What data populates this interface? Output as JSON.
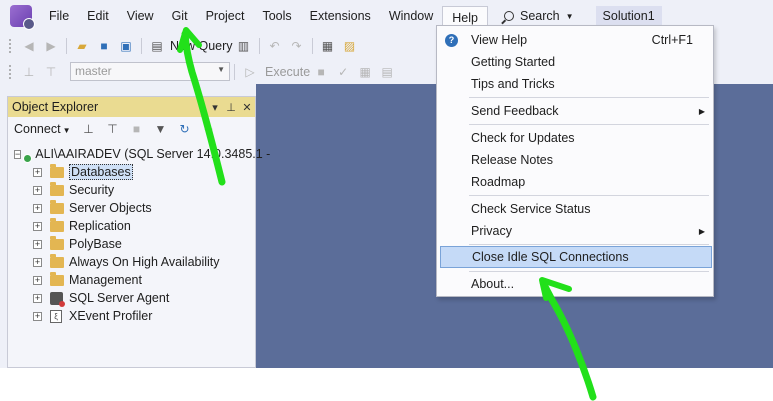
{
  "menubar": {
    "items": [
      "File",
      "Edit",
      "View",
      "Git",
      "Project",
      "Tools",
      "Extensions",
      "Window",
      "Help"
    ],
    "search_label": "Search",
    "solution_label": "Solution1"
  },
  "toolbar": {
    "new_query_label": "New Query",
    "database_value": "master",
    "execute_label": "Execute"
  },
  "object_explorer": {
    "title": "Object Explorer",
    "connect_label": "Connect",
    "server_node": "ALI\\AAIRADEV (SQL Server 14.0.3485.1 -",
    "nodes": [
      "Databases",
      "Security",
      "Server Objects",
      "Replication",
      "PolyBase",
      "Always On High Availability",
      "Management",
      "SQL Server Agent",
      "XEvent Profiler"
    ]
  },
  "help_menu": {
    "items": [
      {
        "label": "View Help",
        "shortcut": "Ctrl+F1"
      },
      {
        "label": "Getting Started"
      },
      {
        "label": "Tips and Tricks"
      },
      {
        "label": "Send Feedback"
      },
      {
        "label": "Check for Updates"
      },
      {
        "label": "Release Notes"
      },
      {
        "label": "Roadmap"
      },
      {
        "label": "Check Service Status"
      },
      {
        "label": "Privacy"
      },
      {
        "label": "Close Idle SQL Connections"
      },
      {
        "label": "About..."
      }
    ]
  },
  "colors": {
    "annotation_arrow": "#22e01a",
    "workspace": "#5b6d99",
    "panel_title": "#eadb91",
    "highlight": "#c5daf7"
  }
}
